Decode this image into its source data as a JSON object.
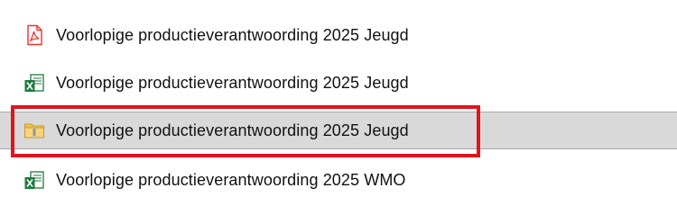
{
  "files": [
    {
      "name": "Voorlopige productieverantwoording 2025 Jeugd",
      "icon": "pdf-file-icon",
      "selected": false
    },
    {
      "name": "Voorlopige productieverantwoording 2025 Jeugd",
      "icon": "excel-file-icon",
      "selected": false
    },
    {
      "name": "Voorlopige productieverantwoording 2025 Jeugd",
      "icon": "zip-folder-icon",
      "selected": true
    },
    {
      "name": "Voorlopige productieverantwoording 2025 WMO",
      "icon": "excel-file-icon",
      "selected": false
    }
  ],
  "colors": {
    "selection_background": "#d9d9d9",
    "highlight_border": "#e0141e",
    "pdf_red": "#e8342f",
    "excel_green": "#1f7a3f",
    "zip_yellow": "#f2c14e"
  }
}
